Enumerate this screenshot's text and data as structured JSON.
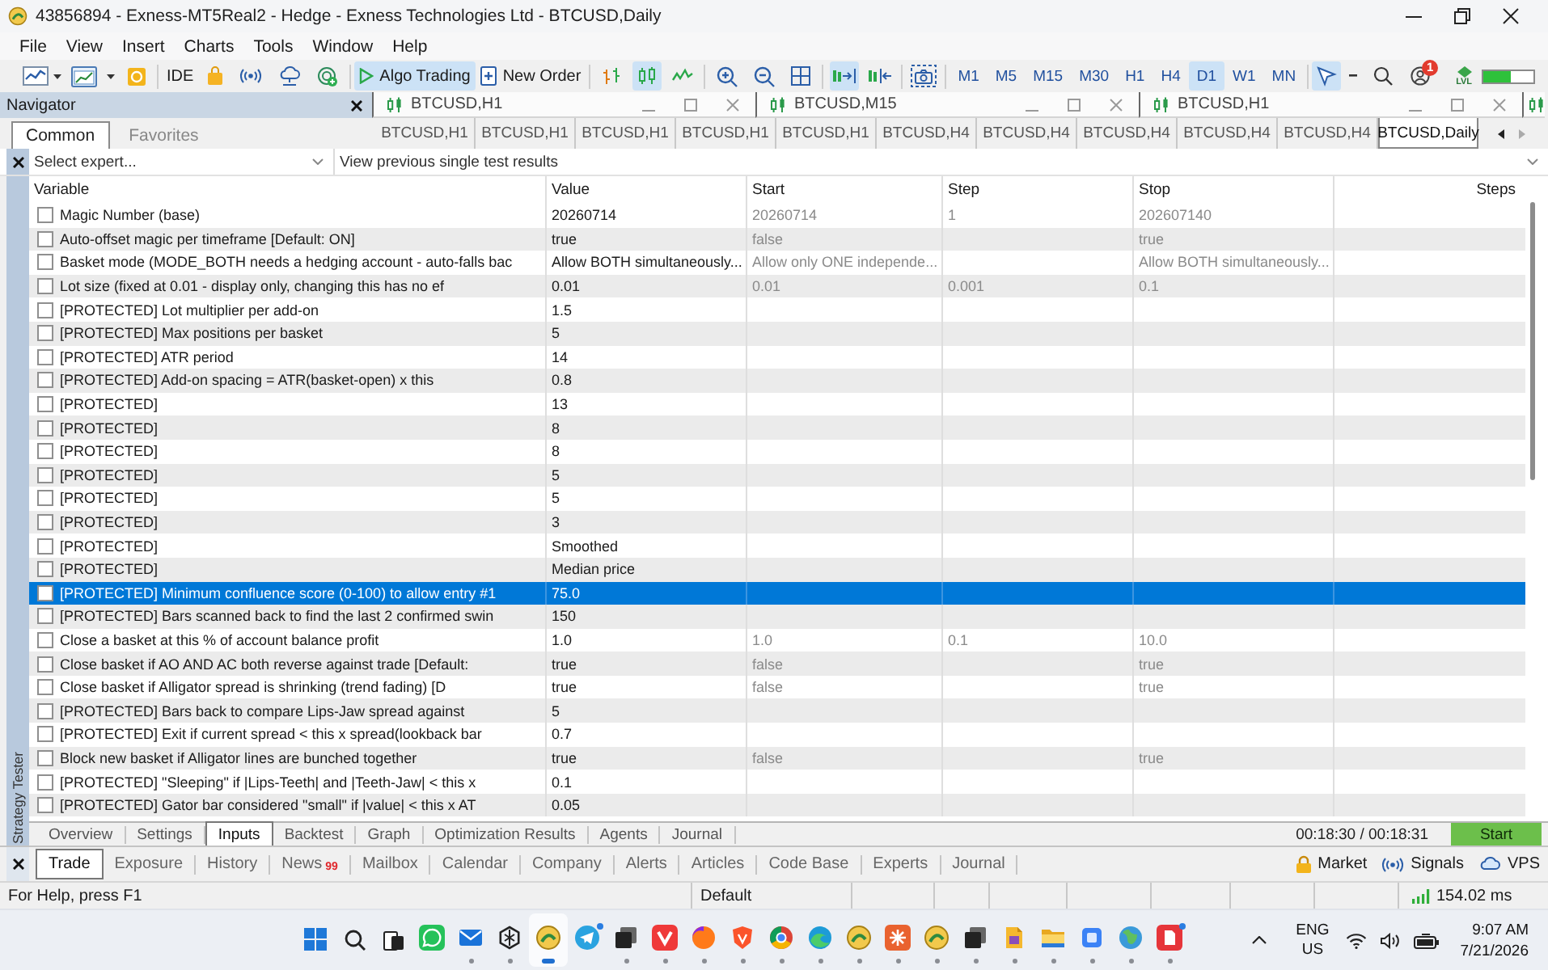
{
  "window": {
    "title": "43856894 - Exness-MT5Real2 - Hedge - Exness Technologies Ltd - BTCUSD,Daily"
  },
  "menu": [
    "File",
    "View",
    "Insert",
    "Charts",
    "Tools",
    "Window",
    "Help"
  ],
  "toolbar": {
    "ide": "IDE",
    "algo_trading": {
      "label": "Algo Trading",
      "on": true
    },
    "new_order": "New Order",
    "chart_types": [
      {
        "selected": false
      },
      {
        "selected": true
      },
      {
        "selected": false
      }
    ],
    "autoscroll": {
      "on": true
    },
    "chart_shift": {
      "on": false
    },
    "timeframes": [
      {
        "label": "M1",
        "selected": false
      },
      {
        "label": "M5",
        "selected": false
      },
      {
        "label": "M15",
        "selected": false
      },
      {
        "label": "M30",
        "selected": false
      },
      {
        "label": "H1",
        "selected": false
      },
      {
        "label": "H4",
        "selected": false
      },
      {
        "label": "D1",
        "selected": true
      },
      {
        "label": "W1",
        "selected": false
      },
      {
        "label": "MN",
        "selected": false
      }
    ],
    "cursor": {
      "selected": true
    },
    "notifications": {
      "count": "1"
    },
    "level_badge": "LVL",
    "level_meter": {
      "level": 0.55
    }
  },
  "navigator": {
    "title": "Navigator",
    "tabs": [
      {
        "label": "Common",
        "selected": true
      },
      {
        "label": "Favorites",
        "selected": false
      }
    ]
  },
  "chart_windows": [
    {
      "title": "BTCUSD,H1"
    },
    {
      "title": "BTCUSD,M15"
    },
    {
      "title": "BTCUSD,H1"
    }
  ],
  "chart_tabs": [
    {
      "label": "BTCUSD,H1",
      "selected": false
    },
    {
      "label": "BTCUSD,H1",
      "selected": false
    },
    {
      "label": "BTCUSD,H1",
      "selected": false
    },
    {
      "label": "BTCUSD,H1",
      "selected": false
    },
    {
      "label": "BTCUSD,H1",
      "selected": false
    },
    {
      "label": "BTCUSD,H4",
      "selected": false
    },
    {
      "label": "BTCUSD,H4",
      "selected": false
    },
    {
      "label": "BTCUSD,H4",
      "selected": false
    },
    {
      "label": "BTCUSD,H4",
      "selected": false
    },
    {
      "label": "BTCUSD,H4",
      "selected": false
    },
    {
      "label": "BTCUSD,Daily",
      "selected": true
    }
  ],
  "tester": {
    "expert": {
      "placeholder": "Select expert..."
    },
    "history": {
      "value": "View previous single test results"
    },
    "side_label": "Strategy Tester",
    "table": {
      "columns": [
        "Variable",
        "Value",
        "Start",
        "Step",
        "Stop",
        "Steps"
      ],
      "rows": [
        {
          "checked": false,
          "selected": false,
          "variable": "Magic Number (base)",
          "value": "20260714",
          "start": "20260714",
          "step": "1",
          "stop": "202607140"
        },
        {
          "checked": false,
          "selected": false,
          "variable": "Auto-offset magic per timeframe [Default: ON]",
          "value": "true",
          "start": "false",
          "stop": "true"
        },
        {
          "checked": false,
          "selected": false,
          "variable": "Basket mode (MODE_BOTH needs a hedging account - auto-falls bac",
          "value": "Allow BOTH simultaneously...",
          "start": "Allow only ONE independe...",
          "stop": "Allow BOTH simultaneously..."
        },
        {
          "checked": false,
          "selected": false,
          "variable": "Lot size (fixed at 0.01 - display only, changing this has no ef",
          "value": "0.01",
          "start": "0.01",
          "step": "0.001",
          "stop": "0.1"
        },
        {
          "checked": false,
          "selected": false,
          "variable": "[PROTECTED] Lot multiplier per add-on",
          "value": "1.5"
        },
        {
          "checked": false,
          "selected": false,
          "variable": "[PROTECTED] Max positions per basket",
          "value": "5"
        },
        {
          "checked": false,
          "selected": false,
          "variable": "[PROTECTED] ATR period",
          "value": "14"
        },
        {
          "checked": false,
          "selected": false,
          "variable": "[PROTECTED] Add-on spacing = ATR(basket-open) x this",
          "value": "0.8"
        },
        {
          "checked": false,
          "selected": false,
          "variable": "[PROTECTED]",
          "value": "13"
        },
        {
          "checked": false,
          "selected": false,
          "variable": "[PROTECTED]",
          "value": "8"
        },
        {
          "checked": false,
          "selected": false,
          "variable": "[PROTECTED]",
          "value": "8"
        },
        {
          "checked": false,
          "selected": false,
          "variable": "[PROTECTED]",
          "value": "5"
        },
        {
          "checked": false,
          "selected": false,
          "variable": "[PROTECTED]",
          "value": "5"
        },
        {
          "checked": false,
          "selected": false,
          "variable": "[PROTECTED]",
          "value": "3"
        },
        {
          "checked": false,
          "selected": false,
          "variable": "[PROTECTED]",
          "value": "Smoothed"
        },
        {
          "checked": false,
          "selected": false,
          "variable": "[PROTECTED]",
          "value": "Median price"
        },
        {
          "checked": false,
          "selected": true,
          "variable": "[PROTECTED] Minimum confluence score (0-100) to allow entry #1",
          "value": "75.0"
        },
        {
          "checked": false,
          "selected": false,
          "variable": "[PROTECTED] Bars scanned back to find the last 2 confirmed swin",
          "value": "150"
        },
        {
          "checked": false,
          "selected": false,
          "variable": "Close a basket at this % of account balance profit",
          "value": "1.0",
          "start": "1.0",
          "step": "0.1",
          "stop": "10.0"
        },
        {
          "checked": false,
          "selected": false,
          "variable": "Close basket if AO AND AC both reverse against trade [Default:",
          "value": "true",
          "start": "false",
          "stop": "true"
        },
        {
          "checked": false,
          "selected": false,
          "variable": "Close basket if Alligator spread is shrinking (trend fading) [D",
          "value": "true",
          "start": "false",
          "stop": "true"
        },
        {
          "checked": false,
          "selected": false,
          "variable": "[PROTECTED] Bars back to compare Lips-Jaw spread against",
          "value": "5"
        },
        {
          "checked": false,
          "selected": false,
          "variable": "[PROTECTED] Exit if current spread < this x spread(lookback bar",
          "value": "0.7"
        },
        {
          "checked": false,
          "selected": false,
          "variable": "Block new basket if Alligator lines are bunched together",
          "value": "true",
          "start": "false",
          "stop": "true"
        },
        {
          "checked": false,
          "selected": false,
          "variable": "[PROTECTED] \"Sleeping\" if |Lips-Teeth| and |Teeth-Jaw| < this x",
          "value": "0.1"
        },
        {
          "checked": false,
          "selected": false,
          "variable": "[PROTECTED] Gator bar considered \"small\" if |value| < this x AT",
          "value": "0.05"
        }
      ]
    },
    "tabs": [
      {
        "label": "Overview",
        "selected": false
      },
      {
        "label": "Settings",
        "selected": false
      },
      {
        "label": "Inputs",
        "selected": true
      },
      {
        "label": "Backtest",
        "selected": false
      },
      {
        "label": "Graph",
        "selected": false
      },
      {
        "label": "Optimization Results",
        "selected": false
      },
      {
        "label": "Agents",
        "selected": false
      },
      {
        "label": "Journal",
        "selected": false
      }
    ],
    "elapsed": "00:18:30 / 00:18:31",
    "start_button": "Start"
  },
  "toolbox": {
    "tabs": [
      {
        "label": "Trade",
        "selected": true
      },
      {
        "label": "Exposure",
        "selected": false
      },
      {
        "label": "History",
        "selected": false
      },
      {
        "label": "News",
        "badge": "99",
        "selected": false
      },
      {
        "label": "Mailbox",
        "selected": false
      },
      {
        "label": "Calendar",
        "selected": false
      },
      {
        "label": "Company",
        "selected": false
      },
      {
        "label": "Alerts",
        "selected": false
      },
      {
        "label": "Articles",
        "selected": false
      },
      {
        "label": "Code Base",
        "selected": false
      },
      {
        "label": "Experts",
        "selected": false
      },
      {
        "label": "Journal",
        "selected": false
      }
    ],
    "services": [
      {
        "label": "Market"
      },
      {
        "label": "Signals"
      },
      {
        "label": "VPS"
      }
    ]
  },
  "status_bar": {
    "help": "For Help, press F1",
    "profile": "Default",
    "ping": "154.02 ms"
  },
  "taskbar": {
    "apps": [
      {
        "running": false,
        "selected": false,
        "notification": false
      },
      {
        "running": true,
        "selected": false,
        "notification": false
      },
      {
        "running": true,
        "selected": false,
        "notification": false
      },
      {
        "running": true,
        "selected": true,
        "notification": false
      },
      {
        "running": false,
        "selected": false,
        "notification": true
      },
      {
        "running": true,
        "selected": false,
        "notification": false
      },
      {
        "running": true,
        "selected": false,
        "notification": false
      },
      {
        "running": true,
        "selected": false,
        "notification": false
      },
      {
        "running": true,
        "selected": false,
        "notification": false
      },
      {
        "running": true,
        "selected": false,
        "notification": false
      },
      {
        "running": true,
        "selected": false,
        "notification": false
      },
      {
        "running": true,
        "selected": false,
        "notification": false
      },
      {
        "running": true,
        "selected": false,
        "notification": false
      },
      {
        "running": true,
        "selected": false,
        "notification": false
      },
      {
        "running": true,
        "selected": false,
        "notification": false
      },
      {
        "running": true,
        "selected": false,
        "notification": false
      },
      {
        "running": true,
        "selected": false,
        "notification": false
      },
      {
        "running": true,
        "selected": false,
        "notification": false
      },
      {
        "running": true,
        "selected": false,
        "notification": false
      },
      {
        "running": true,
        "selected": false,
        "notification": true
      }
    ],
    "tray": {
      "language": "ENG",
      "region": "US",
      "time": "9:07 AM",
      "date": "7/21/2026"
    }
  }
}
